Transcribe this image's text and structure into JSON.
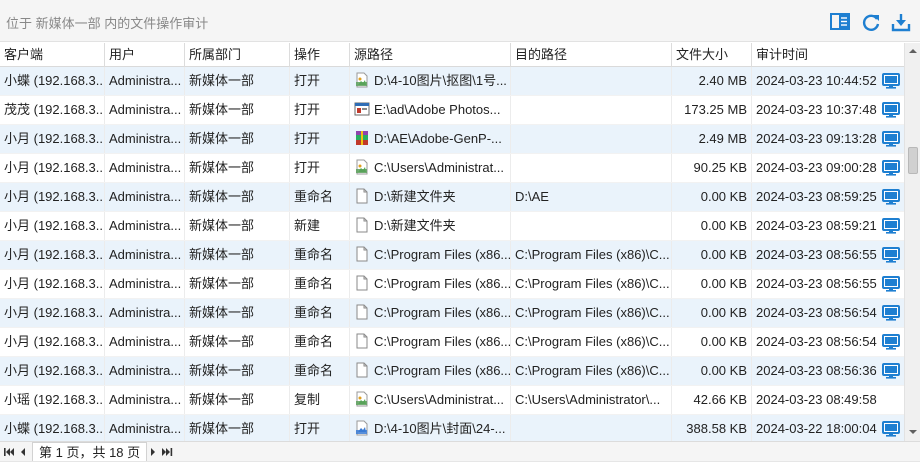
{
  "header": {
    "title": "位于 新媒体一部 内的文件操作审计",
    "icons": [
      "columns-icon",
      "refresh-icon",
      "download-icon"
    ],
    "accent_color": "#1e7fd1"
  },
  "table": {
    "columns": [
      "客户端",
      "用户",
      "所属部门",
      "操作",
      "源路径",
      "目的路径",
      "文件大小",
      "审计时间"
    ],
    "rows": [
      {
        "client": "小蝶 (192.168.3...",
        "user": "Administra...",
        "dept": "新媒体一部",
        "op": "打开",
        "icon": "png",
        "src": "D:\\4-10图片\\抠图\\1号...",
        "dst": "",
        "size": "2.40 MB",
        "time": "2024-03-23 10:44:52",
        "monitor": true
      },
      {
        "client": "茂茂 (192.168.3...",
        "user": "Administra...",
        "dept": "新媒体一部",
        "op": "打开",
        "icon": "exe",
        "src": "E:\\ad\\Adobe Photos...",
        "dst": "",
        "size": "173.25 MB",
        "time": "2024-03-23 10:37:48",
        "monitor": true
      },
      {
        "client": "小月 (192.168.3...",
        "user": "Administra...",
        "dept": "新媒体一部",
        "op": "打开",
        "icon": "rar",
        "src": "D:\\AE\\Adobe-GenP-...",
        "dst": "",
        "size": "2.49 MB",
        "time": "2024-03-23 09:13:28",
        "monitor": true
      },
      {
        "client": "小月 (192.168.3...",
        "user": "Administra...",
        "dept": "新媒体一部",
        "op": "打开",
        "icon": "png",
        "src": "C:\\Users\\Administrat...",
        "dst": "",
        "size": "90.25 KB",
        "time": "2024-03-23 09:00:28",
        "monitor": true
      },
      {
        "client": "小月 (192.168.3...",
        "user": "Administra...",
        "dept": "新媒体一部",
        "op": "重命名",
        "icon": "file",
        "src": "D:\\新建文件夹",
        "dst": "D:\\AE",
        "size": "0.00 KB",
        "time": "2024-03-23 08:59:25",
        "monitor": true
      },
      {
        "client": "小月 (192.168.3...",
        "user": "Administra...",
        "dept": "新媒体一部",
        "op": "新建",
        "icon": "file",
        "src": "D:\\新建文件夹",
        "dst": "",
        "size": "0.00 KB",
        "time": "2024-03-23 08:59:21",
        "monitor": true
      },
      {
        "client": "小月 (192.168.3...",
        "user": "Administra...",
        "dept": "新媒体一部",
        "op": "重命名",
        "icon": "file",
        "src": "C:\\Program Files (x86...",
        "dst": "C:\\Program Files (x86)\\C...",
        "size": "0.00 KB",
        "time": "2024-03-23 08:56:55",
        "monitor": true
      },
      {
        "client": "小月 (192.168.3...",
        "user": "Administra...",
        "dept": "新媒体一部",
        "op": "重命名",
        "icon": "file",
        "src": "C:\\Program Files (x86...",
        "dst": "C:\\Program Files (x86)\\C...",
        "size": "0.00 KB",
        "time": "2024-03-23 08:56:55",
        "monitor": true
      },
      {
        "client": "小月 (192.168.3...",
        "user": "Administra...",
        "dept": "新媒体一部",
        "op": "重命名",
        "icon": "file",
        "src": "C:\\Program Files (x86...",
        "dst": "C:\\Program Files (x86)\\C...",
        "size": "0.00 KB",
        "time": "2024-03-23 08:56:54",
        "monitor": true
      },
      {
        "client": "小月 (192.168.3...",
        "user": "Administra...",
        "dept": "新媒体一部",
        "op": "重命名",
        "icon": "file",
        "src": "C:\\Program Files (x86...",
        "dst": "C:\\Program Files (x86)\\C...",
        "size": "0.00 KB",
        "time": "2024-03-23 08:56:54",
        "monitor": true
      },
      {
        "client": "小月 (192.168.3...",
        "user": "Administra...",
        "dept": "新媒体一部",
        "op": "重命名",
        "icon": "file",
        "src": "C:\\Program Files (x86...",
        "dst": "C:\\Program Files (x86)\\C...",
        "size": "0.00 KB",
        "time": "2024-03-23 08:56:36",
        "monitor": true
      },
      {
        "client": "小瑶 (192.168.3...",
        "user": "Administra...",
        "dept": "新媒体一部",
        "op": "复制",
        "icon": "png",
        "src": "C:\\Users\\Administrat...",
        "dst": "C:\\Users\\Administrator\\...",
        "size": "42.66 KB",
        "time": "2024-03-23 08:49:58",
        "monitor": false
      },
      {
        "client": "小蝶 (192.168.3...",
        "user": "Administra...",
        "dept": "新媒体一部",
        "op": "打开",
        "icon": "jpg",
        "src": "D:\\4-10图片\\封面\\24-...",
        "dst": "",
        "size": "388.58 KB",
        "time": "2024-03-22 18:00:04",
        "monitor": true
      }
    ]
  },
  "pager": {
    "info": "第 1 页，共 18 页"
  }
}
